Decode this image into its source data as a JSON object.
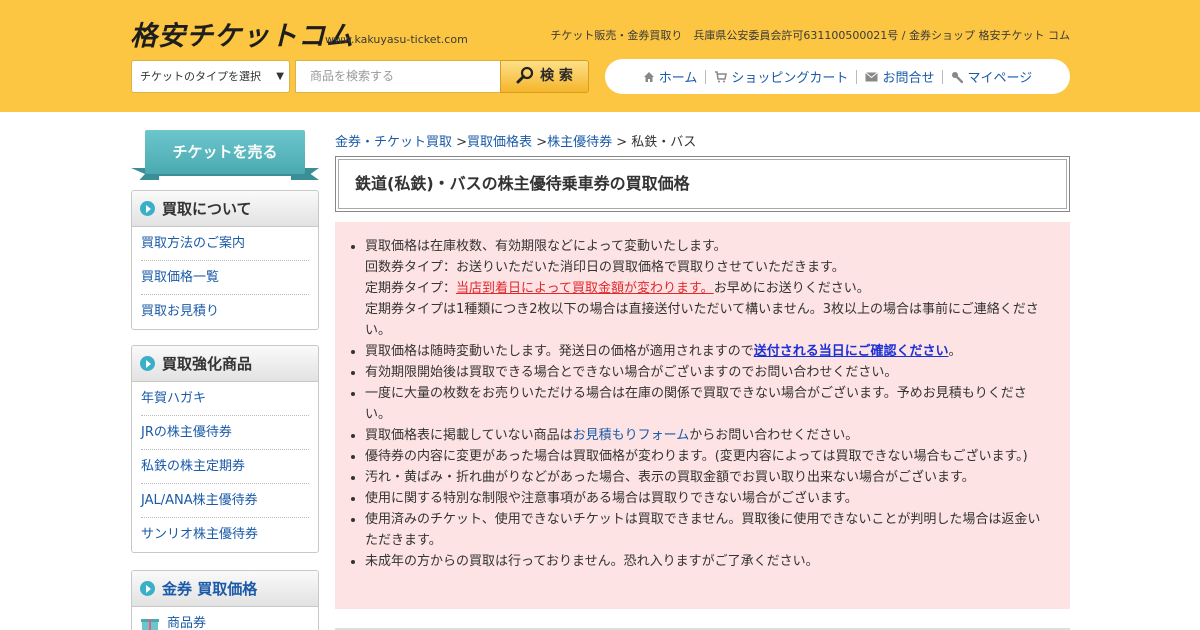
{
  "header": {
    "logo": "格安チケットコム",
    "url": "www.kakuyasu-ticket.com",
    "tagline": "チケット販売・金券買取り　兵庫県公安委員会許可631100500021号 / 金券ショップ 格安チケット コム",
    "select_label": "チケットのタイプを選択",
    "search_placeholder": "商品を検索する",
    "search_button": "検 索",
    "nav": {
      "home": "ホーム",
      "cart": "ショッピングカート",
      "contact": "お問合せ",
      "mypage": "マイページ"
    }
  },
  "sidebar": {
    "sell_banner": "チケットを売る",
    "box1": {
      "title": "買取について",
      "items": [
        "買取方法のご案内",
        "買取価格一覧",
        "買取お見積り"
      ]
    },
    "box2": {
      "title": "買取強化商品",
      "items": [
        "年賀ハガキ",
        "JRの株主優待券",
        "私鉄の株主定期券",
        "JAL/ANA株主優待券",
        "サンリオ株主優待券"
      ]
    },
    "box3": {
      "title": "金券 買取価格",
      "items": [
        "商品券"
      ]
    }
  },
  "breadcrumb": {
    "l1": "金券・チケット買取",
    "l2": "買取価格表",
    "l3": "株主優待券",
    "current": "私鉄・バス",
    "sep": " >"
  },
  "main": {
    "title": "鉄道(私鉄)・バスの株主優待乗車券の買取価格",
    "notes": {
      "n1a": "買取価格は在庫枚数、有効期限などによって変動いたします。",
      "n1b": "回数券タイプ：お送りいただいた消印日の買取価格で買取りさせていただきます。",
      "n1c_pre": "定期券タイプ：",
      "n1c_link": "当店到着日によって買取金額が変わります。",
      "n1c_post": "お早めにお送りください。",
      "n1d": "定期券タイプは1種類につき2枚以下の場合は直接送付いただいて構いません。3枚以上の場合は事前にご連絡ください。",
      "n2_pre": "買取価格は随時変動いたします。発送日の価格が適用されますので",
      "n2_link": "送付される当日にご確認ください",
      "n2_post": "。",
      "n3": "有効期限開始後は買取できる場合とできない場合がございますのでお問い合わせください。",
      "n4": "一度に大量の枚数をお売りいただける場合は在庫の関係で買取できない場合がございます。予めお見積もりください。",
      "n5_pre": "買取価格表に掲載していない商品は",
      "n5_link": "お見積もりフォーム",
      "n5_post": "からお問い合わせください。",
      "n6": "優待券の内容に変更があった場合は買取価格が変わります。(変更内容によっては買取できない場合もございます。)",
      "n7": "汚れ・黄ばみ・折れ曲がりなどがあった場合、表示の買取金額でお買い取り出来ない場合がございます。",
      "n8": "使用に関する特別な制限や注意事項がある場合は買取りできない場合がございます。",
      "n9": "使用済みのチケット、使用できないチケットは買取できません。買取後に使用できないことが判明した場合は返金いただきます。",
      "n10": "未成年の方からの買取は行っておりません。恐れ入りますがご了承ください。"
    }
  }
}
